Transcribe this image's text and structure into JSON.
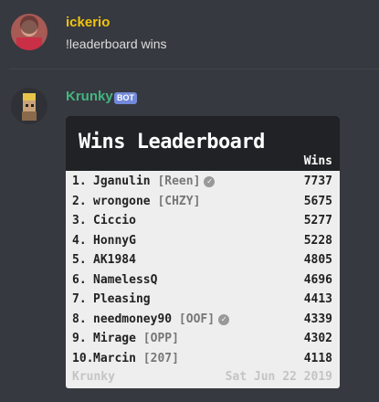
{
  "messages": [
    {
      "username": "ickerio",
      "username_color": "#f1c40f",
      "content": "!leaderboard wins"
    },
    {
      "username": "Krunky",
      "username_color": "#43b581",
      "badge": "BOT",
      "embed": {
        "title": "Wins Leaderboard",
        "column_label": "Wins",
        "rows": [
          {
            "rank": "1.",
            "name": "Jganulin",
            "tag": "[Reen]",
            "verified": true,
            "wins": "7737"
          },
          {
            "rank": "2.",
            "name": "wrongone",
            "tag": "[CHZY]",
            "verified": false,
            "wins": "5675"
          },
          {
            "rank": "3.",
            "name": "Ciccio",
            "tag": "",
            "verified": false,
            "wins": "5277"
          },
          {
            "rank": "4.",
            "name": "HonnyG",
            "tag": "",
            "verified": false,
            "wins": "5228"
          },
          {
            "rank": "5.",
            "name": "AK1984",
            "tag": "",
            "verified": false,
            "wins": "4805"
          },
          {
            "rank": "6.",
            "name": "NamelessQ",
            "tag": "",
            "verified": false,
            "wins": "4696"
          },
          {
            "rank": "7.",
            "name": "Pleasing",
            "tag": "",
            "verified": false,
            "wins": "4413"
          },
          {
            "rank": "8.",
            "name": "needmoney90",
            "tag": "[OOF]",
            "verified": true,
            "wins": "4339"
          },
          {
            "rank": "9.",
            "name": "Mirage",
            "tag": "[OPP]",
            "verified": false,
            "wins": "4302"
          },
          {
            "rank": "10.",
            "name": "Marcin",
            "tag": "[207]",
            "verified": false,
            "wins": "4118"
          }
        ],
        "footer_left": "Krunky",
        "footer_right": "Sat Jun 22 2019"
      }
    }
  ]
}
